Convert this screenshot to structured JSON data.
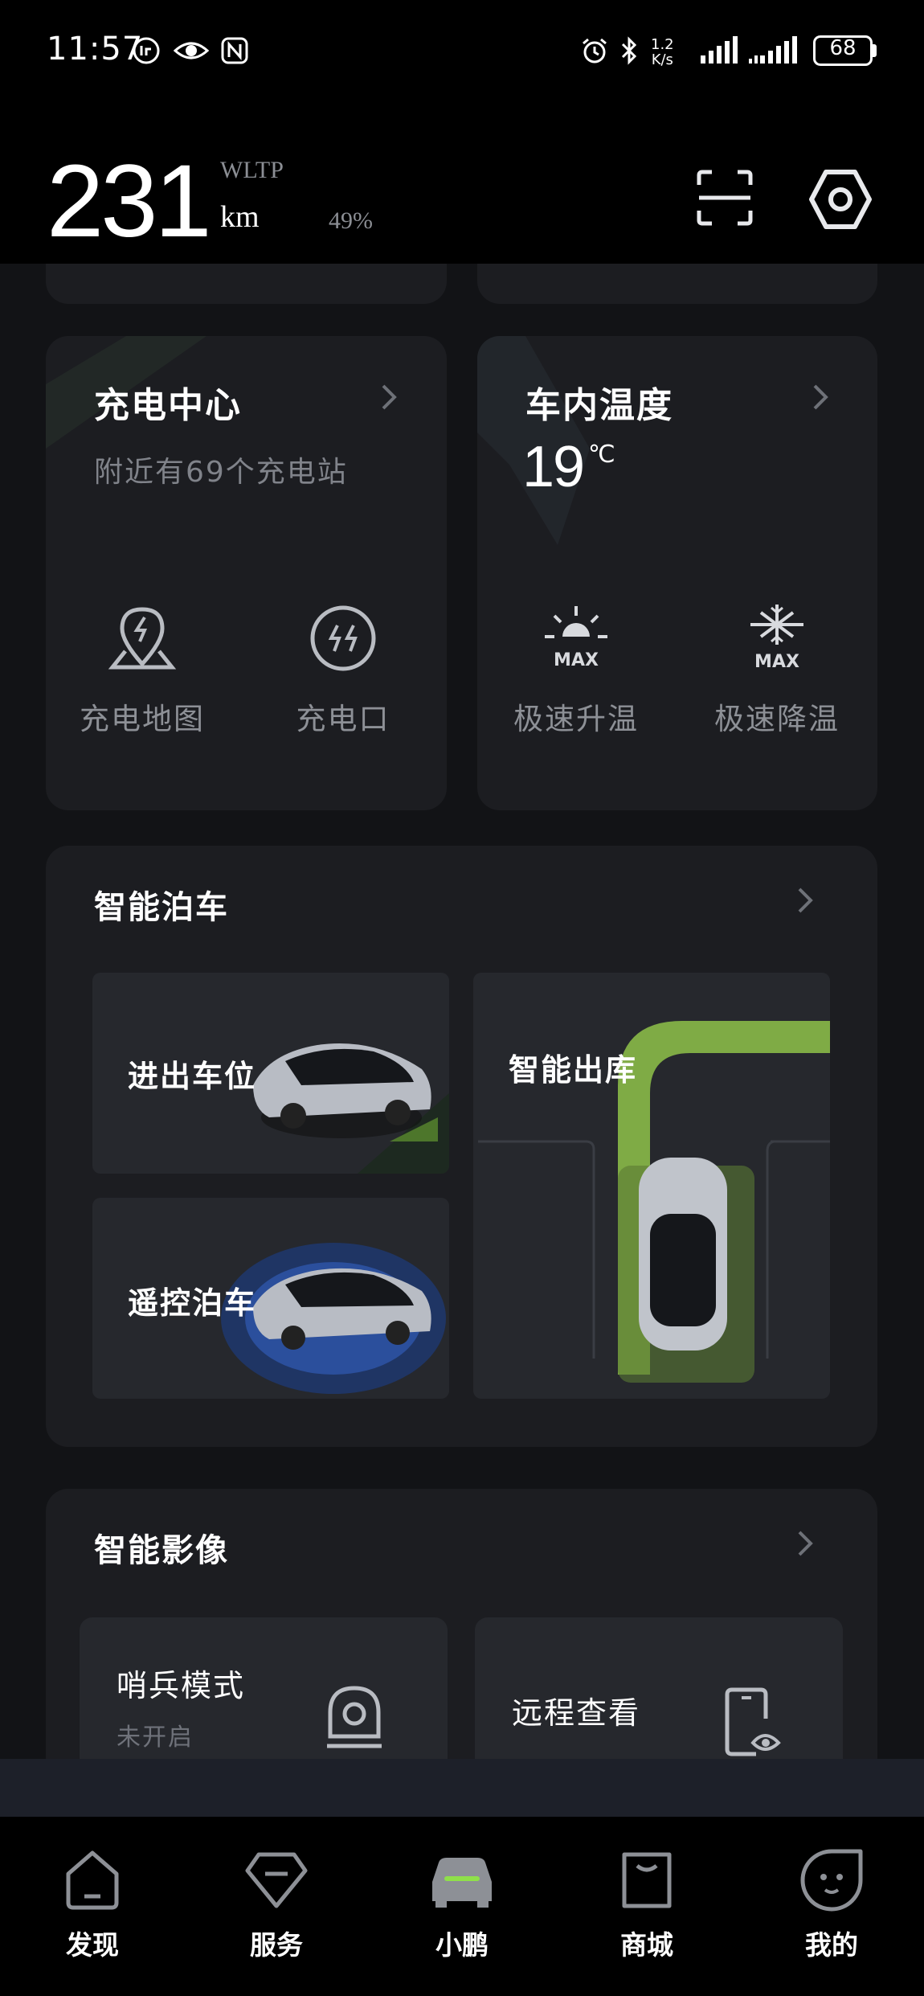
{
  "status_bar": {
    "time": "11:57",
    "net_speed_top": "1.2",
    "net_speed_bottom": "K/s",
    "battery": "68"
  },
  "header": {
    "range_value": "231",
    "range_standard": "WLTP",
    "range_unit": "km",
    "battery_percent": "49%"
  },
  "charging": {
    "title": "充电中心",
    "subtitle": "附近有69个充电站",
    "actions": [
      {
        "label": "充电地图",
        "icon": "charging-map-icon"
      },
      {
        "label": "充电口",
        "icon": "charge-port-icon"
      }
    ]
  },
  "climate": {
    "title": "车内温度",
    "temperature": "19",
    "temperature_unit": "℃",
    "actions": [
      {
        "label": "极速升温",
        "icon": "max-heat-icon",
        "badge": "MAX"
      },
      {
        "label": "极速降温",
        "icon": "max-cool-icon",
        "badge": "MAX"
      }
    ]
  },
  "parking": {
    "title": "智能泊车",
    "tiles": [
      {
        "label": "进出车位"
      },
      {
        "label": "遥控泊车"
      },
      {
        "label": "智能出库"
      }
    ]
  },
  "imaging": {
    "title": "智能影像",
    "tiles": [
      {
        "label": "哨兵模式",
        "status": "未开启",
        "icon": "sentry-camera-icon"
      },
      {
        "label": "远程查看",
        "icon": "remote-view-icon"
      }
    ]
  },
  "nav": {
    "items": [
      {
        "label": "发现",
        "icon": "discover-icon",
        "active": false
      },
      {
        "label": "服务",
        "icon": "service-icon",
        "active": false
      },
      {
        "label": "小鹏",
        "icon": "car-icon",
        "active": true
      },
      {
        "label": "商城",
        "icon": "mall-icon",
        "active": false
      },
      {
        "label": "我的",
        "icon": "profile-icon",
        "active": false
      }
    ]
  },
  "colors": {
    "background": "#121316",
    "card": "#1c1d21",
    "accent_green": "#8fc24a",
    "accent_blue": "#2b4f9c"
  }
}
